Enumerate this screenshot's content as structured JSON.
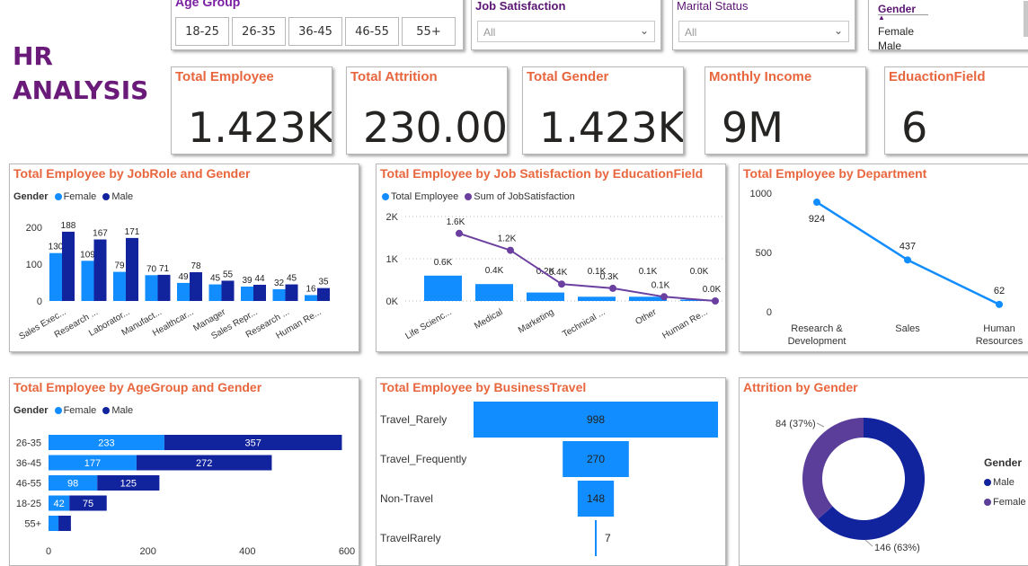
{
  "title": "HR ANALYSIS",
  "slicers": {
    "age_group": {
      "title": "Age Group",
      "options": [
        "18-25",
        "26-35",
        "36-45",
        "46-55",
        "55+"
      ]
    },
    "job_satisfaction": {
      "title": "Job Satisfaction",
      "value": "All"
    },
    "marital_status": {
      "title": "Marital Status",
      "value": "All"
    },
    "gender": {
      "title": "Gender",
      "options": [
        "Female",
        "Male"
      ]
    }
  },
  "kpis": [
    {
      "title": "Total Employee",
      "value": "1.423K"
    },
    {
      "title": "Total Attrition",
      "value": "230.00"
    },
    {
      "title": "Total Gender",
      "value": "1.423K"
    },
    {
      "title": "Monthly Income",
      "value": "9M"
    },
    {
      "title": "EduactionField",
      "value": "6"
    }
  ],
  "colors": {
    "female": "#118dff",
    "male": "#12239e",
    "line": "#6b3fa0",
    "title": "#e8663d",
    "header": "#6a1b7a",
    "dept_line": "#118dff",
    "donut_female": "#5a3e9a"
  },
  "chart_data": [
    {
      "id": "jobrole",
      "type": "bar",
      "title": "Total Employee by JobRole and Gender",
      "legend_title": "Gender",
      "categories": [
        "Sales Exec...",
        "Research ...",
        "Laborator...",
        "Manufact...",
        "Healthcar...",
        "Manager",
        "Sales Repr...",
        "Research ...",
        "Human Re..."
      ],
      "series": [
        {
          "name": "Female",
          "values": [
            130,
            109,
            79,
            70,
            49,
            45,
            39,
            32,
            16
          ]
        },
        {
          "name": "Male",
          "values": [
            188,
            167,
            171,
            71,
            78,
            55,
            44,
            45,
            35
          ]
        }
      ],
      "yticks": [
        "0",
        "100",
        "200"
      ],
      "ylim": [
        0,
        200
      ]
    },
    {
      "id": "jobsat",
      "type": "bar",
      "title": "Total Employee by Job Satisfaction by EducationField",
      "categories": [
        "Life Scienc...",
        "Medical",
        "Marketing",
        "Technical ...",
        "Other",
        "Human Re..."
      ],
      "series": [
        {
          "name": "Total Employee",
          "values": [
            0.6,
            0.4,
            0.2,
            0.1,
            0.1,
            0.0
          ],
          "labels": [
            "0.6K",
            "0.4K",
            "0.2K",
            "0.1K",
            "0.1K",
            "0.0K"
          ]
        },
        {
          "name": "Sum of JobSatisfaction",
          "values": [
            1.6,
            1.2,
            0.4,
            0.3,
            0.1,
            0.0
          ],
          "labels": [
            "1.6K",
            "1.2K",
            "0.4K",
            "0.3K",
            "0.1K",
            "0.0K"
          ]
        }
      ],
      "yticks": [
        "0K",
        "1K",
        "2K"
      ],
      "ylim": [
        0,
        2
      ]
    },
    {
      "id": "dept",
      "type": "line",
      "title": "Total Employee by Department",
      "categories": [
        "Research & Development",
        "Sales",
        "Human Resources"
      ],
      "values": [
        924,
        437,
        62
      ],
      "labels": [
        "924",
        "437",
        "62"
      ],
      "yticks": [
        "0",
        "500",
        "1000"
      ],
      "ylim": [
        0,
        1000
      ]
    },
    {
      "id": "agegroup",
      "type": "bar",
      "title": "Total Employee by AgeGroup and Gender",
      "legend_title": "Gender",
      "categories": [
        "26-35",
        "36-45",
        "46-55",
        "18-25",
        "55+"
      ],
      "series": [
        {
          "name": "Female",
          "values": [
            233,
            177,
            98,
            42,
            20
          ],
          "labels": [
            "233",
            "177",
            "98",
            "42",
            ""
          ]
        },
        {
          "name": "Male",
          "values": [
            357,
            272,
            125,
            75,
            25
          ],
          "labels": [
            "357",
            "272",
            "125",
            "75",
            ""
          ]
        }
      ],
      "xticks": [
        "0",
        "200",
        "400",
        "600"
      ],
      "xlim": [
        0,
        600
      ]
    },
    {
      "id": "travel",
      "type": "bar",
      "title": "Total Employee by BusinessTravel",
      "categories": [
        "Travel_Rarely",
        "Travel_Frequently",
        "Non-Travel",
        "TravelRarely"
      ],
      "values": [
        998,
        270,
        148,
        7
      ],
      "labels": [
        "998",
        "270",
        "148",
        "7"
      ]
    },
    {
      "id": "attrition",
      "type": "pie",
      "title": "Attrition by Gender",
      "legend_title": "Gender",
      "categories": [
        "Male",
        "Female"
      ],
      "values": [
        146,
        84
      ],
      "labels": [
        "146 (63%)",
        "84 (37%)"
      ]
    }
  ]
}
